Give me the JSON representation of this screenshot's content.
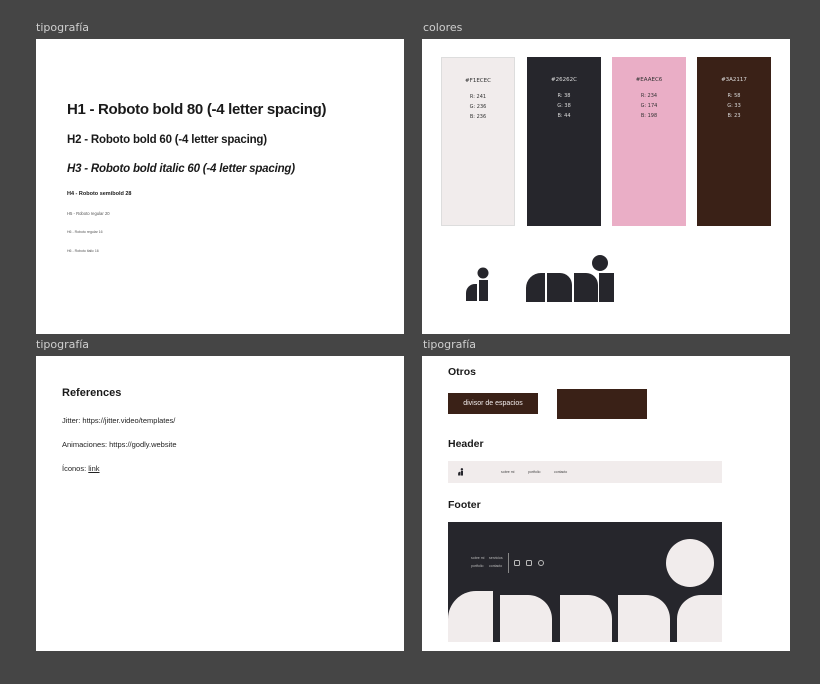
{
  "frames": {
    "typography_label": "tipografía",
    "colors_label": "colores",
    "references_label": "tipografía",
    "ui_label": "tipografía"
  },
  "typography": {
    "h1": "H1 - Roboto bold 80 (-4 letter spacing)",
    "h2": "H2 - Roboto bold 60 (-4 letter spacing)",
    "h3": "H3 - Roboto bold italic 60 (-4 letter spacing)",
    "h4": "H4 - Roboto semibold 28",
    "h5": "H5 - Roboto regular 20",
    "h6a": "H6 - Roboto regular 16",
    "h6b": "H6 - Roboto italic 16"
  },
  "colors": [
    {
      "hex": "#F1ECEC",
      "r": "R: 241",
      "g": "G: 236",
      "b": "B: 236",
      "text": "#333333"
    },
    {
      "hex": "#26262C",
      "r": "R: 38",
      "g": "G: 38",
      "b": "B: 44",
      "text": "#dddddd"
    },
    {
      "hex": "#EAAEC6",
      "r": "R: 234",
      "g": "G: 174",
      "b": "B: 198",
      "text": "#333333"
    },
    {
      "hex": "#3A2117",
      "r": "R: 58",
      "g": "G: 33",
      "b": "B: 23",
      "text": "#dddddd"
    }
  ],
  "references": {
    "title": "References",
    "jitter": "Jitter: https://jitter.video/templates/",
    "animaciones": "Animaciones: https://godly.website",
    "iconos_prefix": "Íconos: ",
    "iconos_link": "link"
  },
  "ui": {
    "otros_title": "Otros",
    "divider_button": "divisor de espacios",
    "header_title": "Header",
    "footer_title": "Footer",
    "nav": [
      "sobre mi",
      "portfolio",
      "contacto"
    ],
    "footer_links": [
      "sobre mi",
      "servicios",
      "portfolio",
      "contacto"
    ]
  }
}
